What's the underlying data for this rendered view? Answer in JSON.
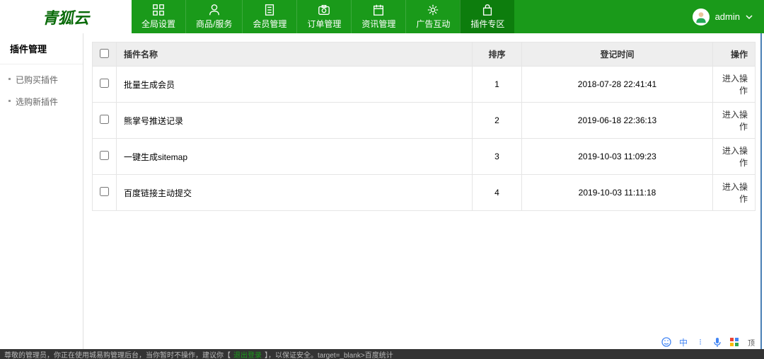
{
  "logo": "青狐云",
  "nav": [
    {
      "label": "全局设置",
      "icon": "grid"
    },
    {
      "label": "商品/服务",
      "icon": "user"
    },
    {
      "label": "会员管理",
      "icon": "document"
    },
    {
      "label": "订单管理",
      "icon": "camera"
    },
    {
      "label": "资讯管理",
      "icon": "calendar"
    },
    {
      "label": "广告互动",
      "icon": "gear"
    },
    {
      "label": "插件专区",
      "icon": "bag",
      "active": true
    }
  ],
  "user": {
    "name": "admin"
  },
  "sidebar": {
    "title": "插件管理",
    "items": [
      "已购买插件",
      "选购新插件"
    ]
  },
  "table": {
    "headers": {
      "name": "插件名称",
      "sort": "排序",
      "time": "登记时间",
      "action": "操作"
    },
    "rows": [
      {
        "name": "批量生成会员",
        "sort": "1",
        "time": "2018-07-28 22:41:41",
        "action": "进入操作"
      },
      {
        "name": "熊掌号推送记录",
        "sort": "2",
        "time": "2019-06-18 22:36:13",
        "action": "进入操作"
      },
      {
        "name": "一键生成sitemap",
        "sort": "3",
        "time": "2019-10-03 11:09:23",
        "action": "进入操作"
      },
      {
        "name": "百度链接主动提交",
        "sort": "4",
        "time": "2019-10-03 11:11:18",
        "action": "进入操作"
      }
    ]
  },
  "footer": {
    "prefix": "尊敬的管理员，你正在使用城易购管理后台，当你暂时不操作，建议你【",
    "link": "退出登录",
    "suffix": "】，以保证安全。target=_blank>百度统计"
  },
  "icons_text": "中"
}
